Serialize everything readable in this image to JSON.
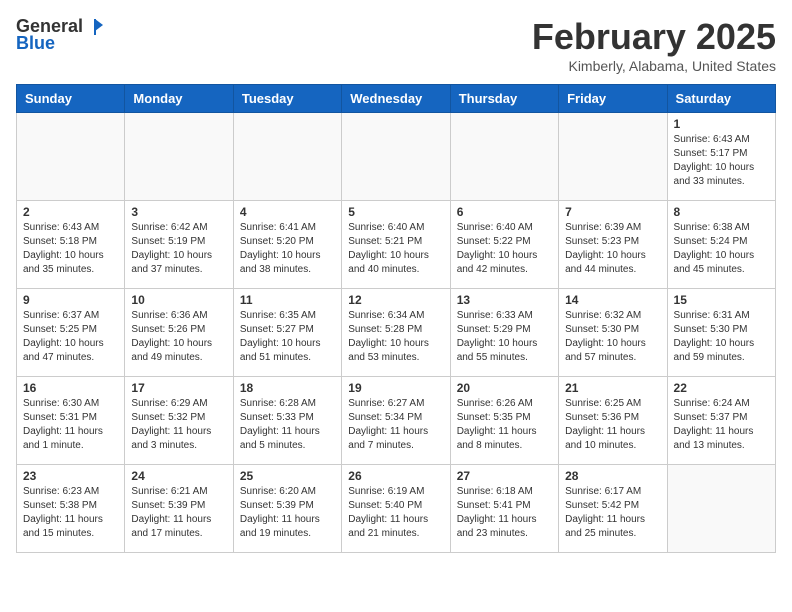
{
  "header": {
    "logo_line1": "General",
    "logo_line2": "Blue",
    "title": "February 2025",
    "subtitle": "Kimberly, Alabama, United States"
  },
  "weekdays": [
    "Sunday",
    "Monday",
    "Tuesday",
    "Wednesday",
    "Thursday",
    "Friday",
    "Saturday"
  ],
  "weeks": [
    [
      {
        "day": "",
        "info": ""
      },
      {
        "day": "",
        "info": ""
      },
      {
        "day": "",
        "info": ""
      },
      {
        "day": "",
        "info": ""
      },
      {
        "day": "",
        "info": ""
      },
      {
        "day": "",
        "info": ""
      },
      {
        "day": "1",
        "info": "Sunrise: 6:43 AM\nSunset: 5:17 PM\nDaylight: 10 hours and 33 minutes."
      }
    ],
    [
      {
        "day": "2",
        "info": "Sunrise: 6:43 AM\nSunset: 5:18 PM\nDaylight: 10 hours and 35 minutes."
      },
      {
        "day": "3",
        "info": "Sunrise: 6:42 AM\nSunset: 5:19 PM\nDaylight: 10 hours and 37 minutes."
      },
      {
        "day": "4",
        "info": "Sunrise: 6:41 AM\nSunset: 5:20 PM\nDaylight: 10 hours and 38 minutes."
      },
      {
        "day": "5",
        "info": "Sunrise: 6:40 AM\nSunset: 5:21 PM\nDaylight: 10 hours and 40 minutes."
      },
      {
        "day": "6",
        "info": "Sunrise: 6:40 AM\nSunset: 5:22 PM\nDaylight: 10 hours and 42 minutes."
      },
      {
        "day": "7",
        "info": "Sunrise: 6:39 AM\nSunset: 5:23 PM\nDaylight: 10 hours and 44 minutes."
      },
      {
        "day": "8",
        "info": "Sunrise: 6:38 AM\nSunset: 5:24 PM\nDaylight: 10 hours and 45 minutes."
      }
    ],
    [
      {
        "day": "9",
        "info": "Sunrise: 6:37 AM\nSunset: 5:25 PM\nDaylight: 10 hours and 47 minutes."
      },
      {
        "day": "10",
        "info": "Sunrise: 6:36 AM\nSunset: 5:26 PM\nDaylight: 10 hours and 49 minutes."
      },
      {
        "day": "11",
        "info": "Sunrise: 6:35 AM\nSunset: 5:27 PM\nDaylight: 10 hours and 51 minutes."
      },
      {
        "day": "12",
        "info": "Sunrise: 6:34 AM\nSunset: 5:28 PM\nDaylight: 10 hours and 53 minutes."
      },
      {
        "day": "13",
        "info": "Sunrise: 6:33 AM\nSunset: 5:29 PM\nDaylight: 10 hours and 55 minutes."
      },
      {
        "day": "14",
        "info": "Sunrise: 6:32 AM\nSunset: 5:30 PM\nDaylight: 10 hours and 57 minutes."
      },
      {
        "day": "15",
        "info": "Sunrise: 6:31 AM\nSunset: 5:30 PM\nDaylight: 10 hours and 59 minutes."
      }
    ],
    [
      {
        "day": "16",
        "info": "Sunrise: 6:30 AM\nSunset: 5:31 PM\nDaylight: 11 hours and 1 minute."
      },
      {
        "day": "17",
        "info": "Sunrise: 6:29 AM\nSunset: 5:32 PM\nDaylight: 11 hours and 3 minutes."
      },
      {
        "day": "18",
        "info": "Sunrise: 6:28 AM\nSunset: 5:33 PM\nDaylight: 11 hours and 5 minutes."
      },
      {
        "day": "19",
        "info": "Sunrise: 6:27 AM\nSunset: 5:34 PM\nDaylight: 11 hours and 7 minutes."
      },
      {
        "day": "20",
        "info": "Sunrise: 6:26 AM\nSunset: 5:35 PM\nDaylight: 11 hours and 8 minutes."
      },
      {
        "day": "21",
        "info": "Sunrise: 6:25 AM\nSunset: 5:36 PM\nDaylight: 11 hours and 10 minutes."
      },
      {
        "day": "22",
        "info": "Sunrise: 6:24 AM\nSunset: 5:37 PM\nDaylight: 11 hours and 13 minutes."
      }
    ],
    [
      {
        "day": "23",
        "info": "Sunrise: 6:23 AM\nSunset: 5:38 PM\nDaylight: 11 hours and 15 minutes."
      },
      {
        "day": "24",
        "info": "Sunrise: 6:21 AM\nSunset: 5:39 PM\nDaylight: 11 hours and 17 minutes."
      },
      {
        "day": "25",
        "info": "Sunrise: 6:20 AM\nSunset: 5:39 PM\nDaylight: 11 hours and 19 minutes."
      },
      {
        "day": "26",
        "info": "Sunrise: 6:19 AM\nSunset: 5:40 PM\nDaylight: 11 hours and 21 minutes."
      },
      {
        "day": "27",
        "info": "Sunrise: 6:18 AM\nSunset: 5:41 PM\nDaylight: 11 hours and 23 minutes."
      },
      {
        "day": "28",
        "info": "Sunrise: 6:17 AM\nSunset: 5:42 PM\nDaylight: 11 hours and 25 minutes."
      },
      {
        "day": "",
        "info": ""
      }
    ]
  ]
}
